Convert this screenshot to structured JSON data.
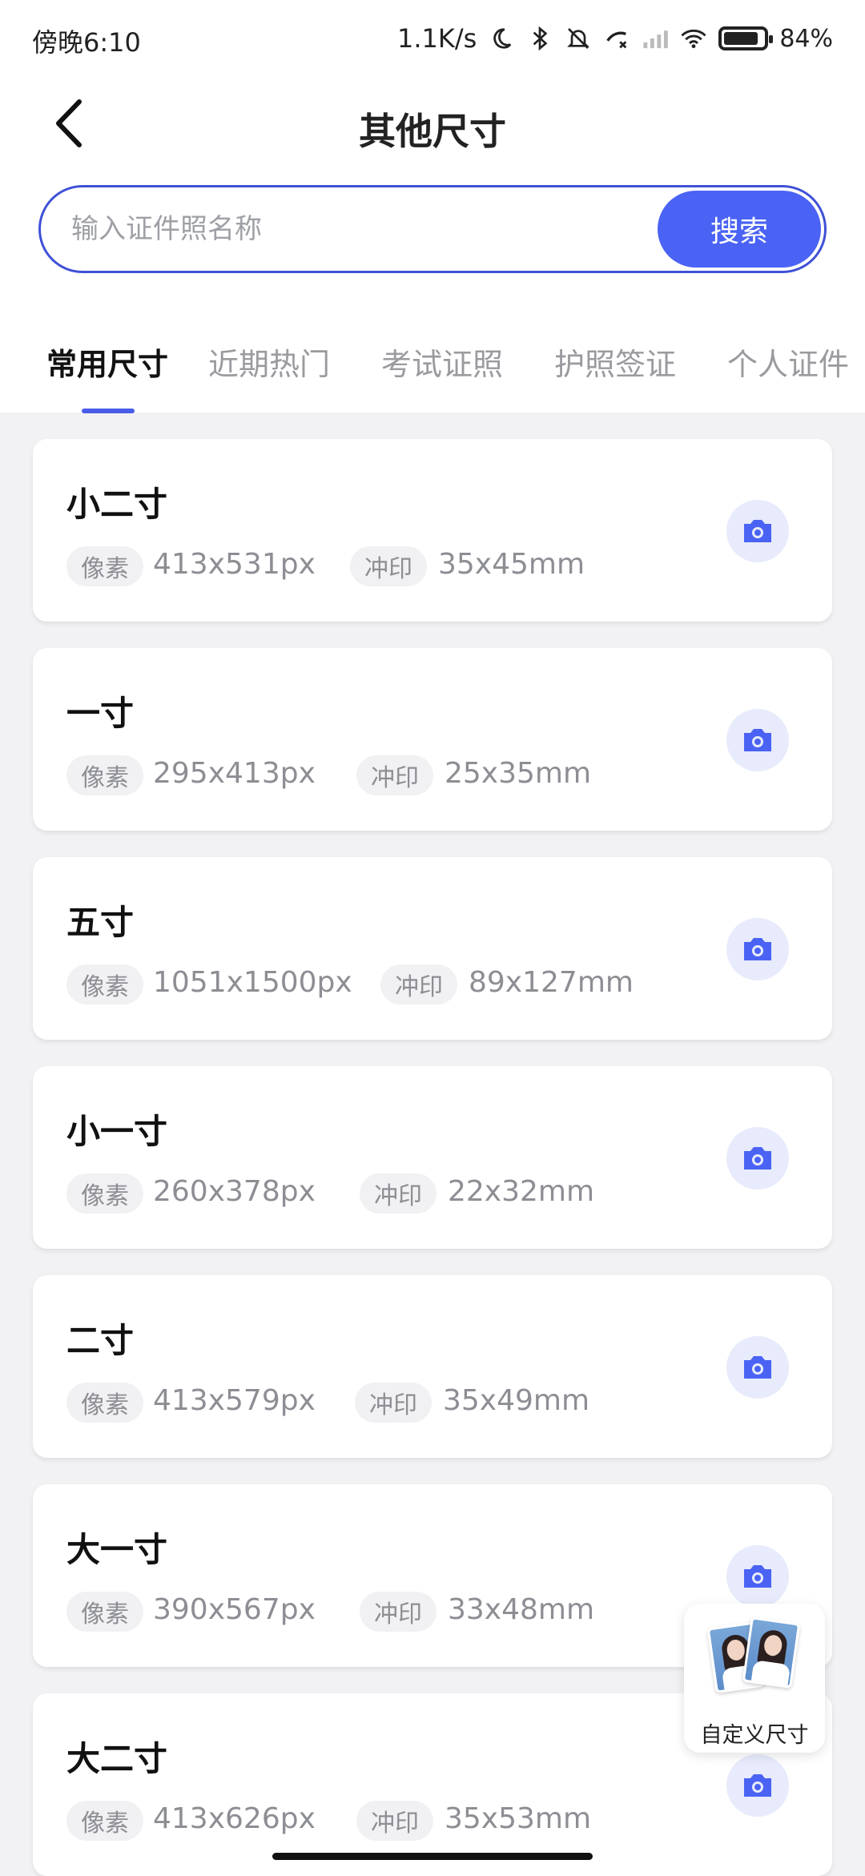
{
  "status_bar": {
    "time": "傍晚6:10",
    "network_speed": "1.1K/s",
    "battery": "84%",
    "battery_level": 0.84
  },
  "header": {
    "title": "其他尺寸"
  },
  "search": {
    "placeholder": "输入证件照名称",
    "button_label": "搜索"
  },
  "tabs": [
    {
      "label": "常用尺寸",
      "active": true
    },
    {
      "label": "近期热门",
      "active": false
    },
    {
      "label": "考试证照",
      "active": false
    },
    {
      "label": "护照签证",
      "active": false
    },
    {
      "label": "个人证件",
      "active": false
    }
  ],
  "labels": {
    "pixel": "像素",
    "print": "冲印"
  },
  "sizes": [
    {
      "name": "小二寸",
      "pixels": "413x531px",
      "print": "35x45mm"
    },
    {
      "name": "一寸",
      "pixels": "295x413px",
      "print": "25x35mm"
    },
    {
      "name": "五寸",
      "pixels": "1051x1500px",
      "print": "89x127mm"
    },
    {
      "name": "小一寸",
      "pixels": "260x378px",
      "print": "22x32mm"
    },
    {
      "name": "二寸",
      "pixels": "413x579px",
      "print": "35x49mm"
    },
    {
      "name": "大一寸",
      "pixels": "390x567px",
      "print": "33x48mm"
    },
    {
      "name": "大二寸",
      "pixels": "413x626px",
      "print": "35x53mm"
    }
  ],
  "custom_size": {
    "label": "自定义尺寸"
  },
  "colors": {
    "accent": "#4a63f4",
    "tag_bg": "#f1f1f3",
    "camera_bg": "#e7ebfb"
  }
}
